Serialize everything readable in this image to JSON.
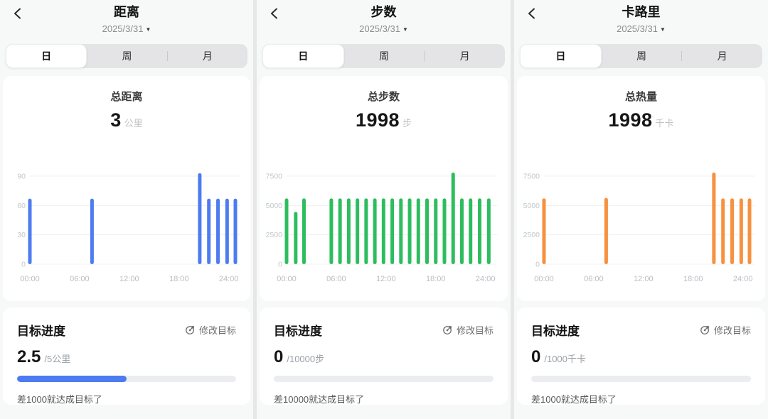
{
  "panels": [
    {
      "id": "distance",
      "accent": "#4d7bf0",
      "header": {
        "title": "距离",
        "date": "2025/3/31",
        "caret": "▼"
      },
      "tabs": {
        "day": "日",
        "week": "周",
        "month": "月",
        "selected": "日"
      },
      "summary": {
        "label": "总距离",
        "value": "3",
        "unit": "公里"
      },
      "chart_data": {
        "type": "bar",
        "title": "总距离 3公里",
        "x_ticks": [
          "00:00",
          "06:00",
          "12:00",
          "18:00",
          "24:00"
        ],
        "x_tick_hours": [
          0,
          6,
          12,
          18,
          24
        ],
        "x_max_hour": 25.4,
        "y_ticks": [
          90,
          60,
          30,
          0
        ],
        "ylim": [
          0,
          97
        ],
        "grid": true,
        "bar_color": "#4d7bf0",
        "bars": [
          [
            0,
            67
          ],
          [
            7.5,
            67
          ],
          [
            20.5,
            93
          ],
          [
            21.6,
            67
          ],
          [
            22.7,
            67
          ],
          [
            23.8,
            67
          ],
          [
            24.8,
            67
          ]
        ]
      },
      "goal": {
        "section_title": "目标进度",
        "edit_label": "修改目标",
        "current": "2.5",
        "target": "/5公里",
        "progress_percent": 50,
        "hint": "差1000就达成目标了"
      }
    },
    {
      "id": "steps",
      "accent": "#2ebd5e",
      "header": {
        "title": "步数",
        "date": "2025/3/31",
        "caret": "▼"
      },
      "tabs": {
        "day": "日",
        "week": "周",
        "month": "月",
        "selected": "日"
      },
      "summary": {
        "label": "总步数",
        "value": "1998",
        "unit": "步"
      },
      "chart_data": {
        "type": "bar",
        "title": "总步数 1998步",
        "x_ticks": [
          "00:00",
          "06:00",
          "12:00",
          "18:00",
          "24:00"
        ],
        "x_tick_hours": [
          0,
          6,
          12,
          18,
          24
        ],
        "x_max_hour": 25.4,
        "y_ticks": [
          7500,
          5000,
          2500,
          0
        ],
        "ylim": [
          0,
          8100
        ],
        "grid": true,
        "bar_color": "#2ebd5e",
        "bars": [
          [
            0,
            5600
          ],
          [
            1.1,
            4450
          ],
          [
            2.1,
            5600
          ],
          [
            5.4,
            5600
          ],
          [
            6.45,
            5600
          ],
          [
            7.5,
            5600
          ],
          [
            8.55,
            5600
          ],
          [
            9.6,
            5600
          ],
          [
            10.65,
            5600
          ],
          [
            11.7,
            5600
          ],
          [
            12.75,
            5600
          ],
          [
            13.8,
            5600
          ],
          [
            14.85,
            5600
          ],
          [
            15.9,
            5600
          ],
          [
            16.95,
            5600
          ],
          [
            18.0,
            5600
          ],
          [
            19.05,
            5600
          ],
          [
            20.1,
            7800
          ],
          [
            21.15,
            5600
          ],
          [
            22.2,
            5600
          ],
          [
            23.3,
            5600
          ],
          [
            24.4,
            5600
          ]
        ]
      },
      "goal": {
        "section_title": "目标进度",
        "edit_label": "修改目标",
        "current": "0",
        "target": "/10000步",
        "progress_percent": 0,
        "hint": "差10000就达成目标了"
      }
    },
    {
      "id": "calories",
      "accent": "#f7913d",
      "header": {
        "title": "卡路里",
        "date": "2025/3/31",
        "caret": "▼"
      },
      "tabs": {
        "day": "日",
        "week": "周",
        "month": "月",
        "selected": "日"
      },
      "summary": {
        "label": "总热量",
        "value": "1998",
        "unit": "千卡"
      },
      "chart_data": {
        "type": "bar",
        "title": "总热量 1998千卡",
        "x_ticks": [
          "00:00",
          "06:00",
          "12:00",
          "18:00",
          "24:00"
        ],
        "x_tick_hours": [
          0,
          6,
          12,
          18,
          24
        ],
        "x_max_hour": 25.4,
        "y_ticks": [
          7500,
          5000,
          2500,
          0
        ],
        "ylim": [
          0,
          8100
        ],
        "grid": true,
        "bar_color": "#f7913d",
        "bars": [
          [
            0,
            5600
          ],
          [
            7.5,
            5650
          ],
          [
            20.5,
            7800
          ],
          [
            21.6,
            5600
          ],
          [
            22.7,
            5600
          ],
          [
            23.8,
            5600
          ],
          [
            24.8,
            5600
          ]
        ]
      },
      "goal": {
        "section_title": "目标进度",
        "edit_label": "修改目标",
        "current": "0",
        "target": "/1000千卡",
        "progress_percent": 0,
        "hint": "差1000就达成目标了"
      }
    }
  ],
  "chart_style": {
    "gridline_color": "#f0f0f1",
    "y_label_color": "#c3c6ca",
    "x_label_color": "#b9bdc2"
  }
}
